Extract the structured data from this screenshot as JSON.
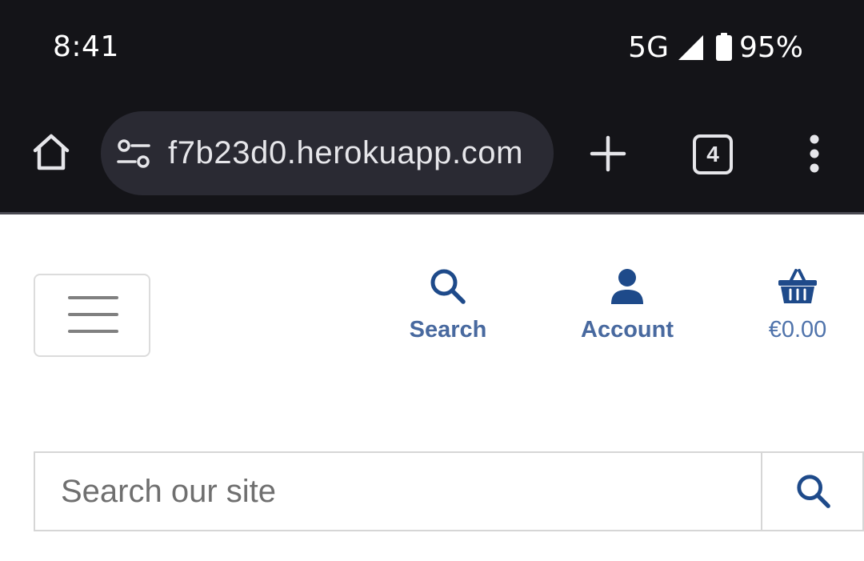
{
  "status_bar": {
    "time": "8:41",
    "network": "5G",
    "battery": "95%"
  },
  "browser": {
    "url": "f7b23d0.herokuapp.com",
    "tab_count": "4"
  },
  "header": {
    "search_label": "Search",
    "account_label": "Account",
    "cart_total": "€0.00"
  },
  "search": {
    "placeholder": "Search our site"
  },
  "colors": {
    "chrome_background": "#141418",
    "url_bar_background": "#2a2a33",
    "brand_blue": "#1e4a8a",
    "nav_text": "#48699f"
  },
  "icons": {
    "home": "home-icon",
    "site_settings": "site-settings-icon",
    "new_tab": "plus-icon",
    "tabs": "tab-switcher-icon",
    "menu": "more-vert-icon",
    "hamburger": "hamburger-icon",
    "search": "search-icon",
    "account": "person-icon",
    "cart": "basket-icon"
  }
}
